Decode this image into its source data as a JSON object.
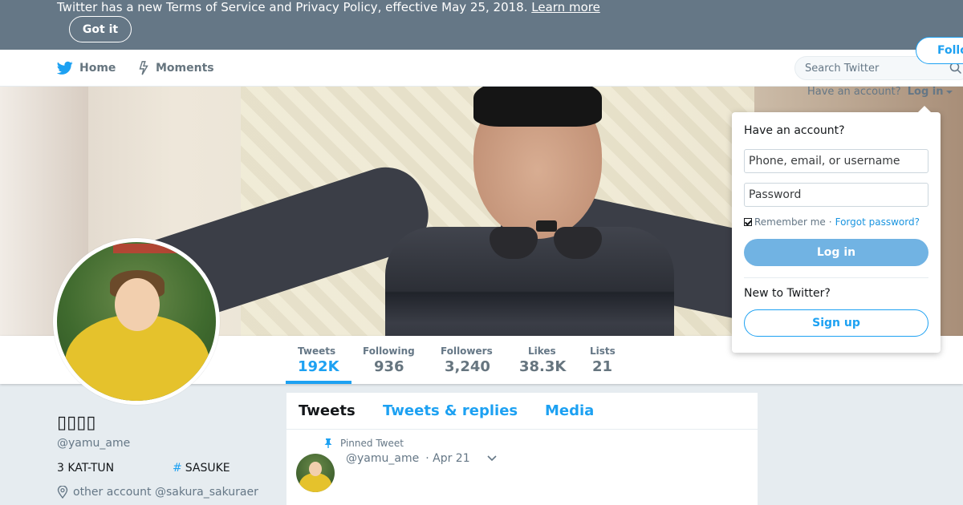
{
  "notice": {
    "text": "Twitter has a new Terms of Service and Privacy Policy, effective May 25, 2018.",
    "learn_more": "Learn more",
    "got_it": "Got it"
  },
  "nav": {
    "home": "Home",
    "moments": "Moments",
    "search_placeholder": "Search Twitter"
  },
  "account_prompt": {
    "have_account": "Have an account?",
    "login": "Log in"
  },
  "login_panel": {
    "title": "Have an account?",
    "username_placeholder": "Phone, email, or username",
    "password_placeholder": "Password",
    "remember_me": "Remember me",
    "separator": "·",
    "forgot_password": "Forgot password?",
    "login_button": "Log in",
    "new_to_twitter": "New to Twitter?",
    "signup_button": "Sign up"
  },
  "stats": [
    {
      "label": "Tweets",
      "value": "192K"
    },
    {
      "label": "Following",
      "value": "936"
    },
    {
      "label": "Followers",
      "value": "3,240"
    },
    {
      "label": "Likes",
      "value": "38.3K"
    },
    {
      "label": "Lists",
      "value": "21"
    }
  ],
  "follow_button": "Follow",
  "profile": {
    "name": "▯▯▯▯",
    "handle": "@yamu_ame",
    "item_1": "3 KAT-TUN",
    "item_2_hash": "#",
    "item_2": "SASUKE",
    "location": "other account @sakura_sakuraer"
  },
  "timeline": {
    "tabs": [
      "Tweets",
      "Tweets & replies",
      "Media"
    ],
    "pinned_label": "Pinned Tweet",
    "tweet_handle": "@yamu_ame",
    "tweet_date": "· Apr 21"
  },
  "colors": {
    "accent": "#1da1f2",
    "notice_bg": "#657786",
    "page_bg": "#e6ecf0",
    "login_button": "#71b3e3"
  }
}
